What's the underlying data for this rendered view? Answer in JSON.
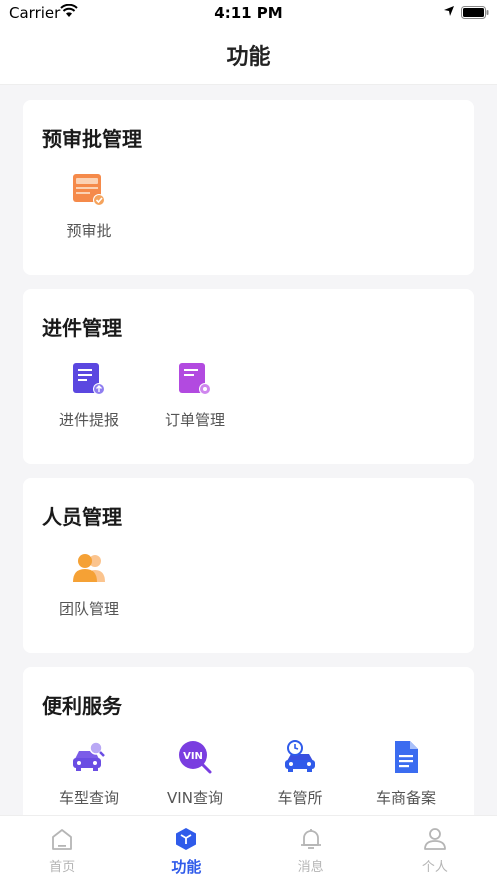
{
  "status": {
    "carrier": "Carrier",
    "time": "4:11 PM"
  },
  "nav": {
    "title": "功能"
  },
  "sections": [
    {
      "title": "预审批管理",
      "items": [
        {
          "label": "预审批",
          "icon": "pre-approval-icon"
        }
      ]
    },
    {
      "title": "进件管理",
      "items": [
        {
          "label": "进件提报",
          "icon": "application-submit-icon"
        },
        {
          "label": "订单管理",
          "icon": "order-management-icon"
        }
      ]
    },
    {
      "title": "人员管理",
      "items": [
        {
          "label": "团队管理",
          "icon": "team-management-icon"
        }
      ]
    },
    {
      "title": "便利服务",
      "items": [
        {
          "label": "车型查询",
          "icon": "car-model-search-icon"
        },
        {
          "label": "VIN查询",
          "icon": "vin-search-icon"
        },
        {
          "label": "车管所",
          "icon": "vehicle-office-icon"
        },
        {
          "label": "车商备案",
          "icon": "dealer-filing-icon"
        }
      ]
    }
  ],
  "tabs": [
    {
      "label": "首页",
      "icon": "home-icon",
      "active": false
    },
    {
      "label": "功能",
      "icon": "function-cube-icon",
      "active": true
    },
    {
      "label": "消息",
      "icon": "bell-icon",
      "active": false
    },
    {
      "label": "个人",
      "icon": "person-icon",
      "active": false
    }
  ],
  "colors": {
    "accent": "#2f5bea",
    "orange": "#f5793b",
    "purple": "#6a4de3",
    "magenta": "#b24ae0"
  }
}
